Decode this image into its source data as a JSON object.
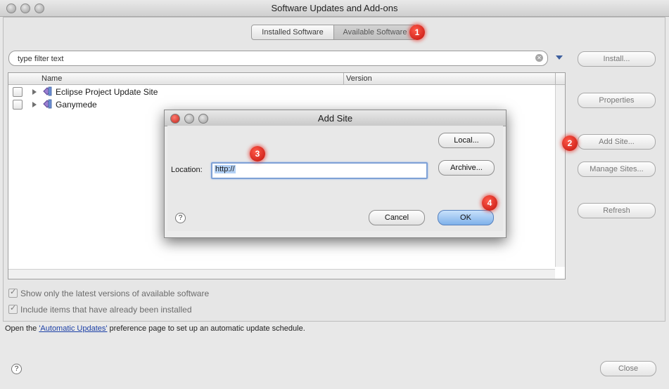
{
  "window": {
    "title": "Software Updates and Add-ons"
  },
  "tabs": [
    {
      "label": "Installed Software"
    },
    {
      "label": "Available Software"
    }
  ],
  "filter": {
    "placeholder": "type filter text"
  },
  "table": {
    "columns": [
      "Name",
      "Version"
    ],
    "rows": [
      {
        "name": "Eclipse Project Update Site"
      },
      {
        "name": "Ganymede"
      }
    ]
  },
  "side_buttons": {
    "install": "Install...",
    "properties": "Properties",
    "add_site": "Add Site...",
    "manage_sites": "Manage Sites...",
    "refresh": "Refresh"
  },
  "options": {
    "latest_only": "Show only the latest versions of available software",
    "include_installed": "Include items that have already been installed"
  },
  "info": {
    "prefix": "Open the ",
    "link": "'Automatic Updates'",
    "suffix": " preference page to set up an automatic update schedule."
  },
  "help_glyph": "?",
  "close_button": "Close",
  "dialog": {
    "title": "Add Site",
    "location_label": "Location:",
    "location_value": "http://",
    "local_button": "Local...",
    "archive_button": "Archive...",
    "cancel_button": "Cancel",
    "ok_button": "OK"
  },
  "badges": [
    "1",
    "2",
    "3",
    "4"
  ],
  "colors": {
    "accent_link": "#1b3fa6",
    "badge_red": "#d8231a",
    "ok_blue": "#7fb1ea"
  }
}
